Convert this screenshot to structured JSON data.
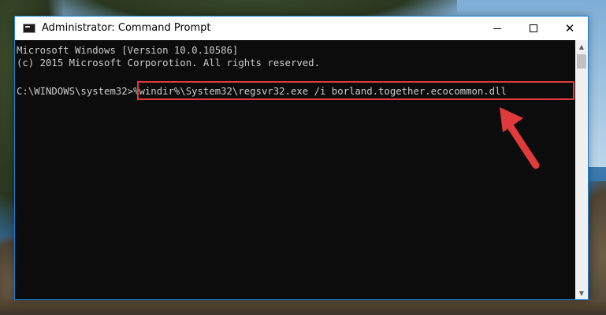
{
  "window": {
    "title": "Administrator: Command Prompt",
    "icon": "cmd-icon",
    "controls": {
      "minimize_icon": "minimize-icon",
      "maximize_icon": "maximize-icon",
      "close_icon": "close-icon",
      "close_glyph": "✕"
    }
  },
  "console": {
    "lines": [
      "Microsoft Windows [Version 10.0.10586]",
      "(c) 2015 Microsoft Corporotion. All rights reserved."
    ],
    "prompt": "C:\\WINDOWS\\system32>",
    "command": "%windir%\\System32\\regsvr32.exe /i borland.together.ecocommon.dll"
  },
  "scrollbar": {
    "up_glyph": "▲",
    "down_glyph": "▼"
  },
  "annotation": {
    "highlight_color": "#e03a3a",
    "arrow_color": "#e03a3a",
    "arrow_icon": "red-arrow-icon"
  }
}
